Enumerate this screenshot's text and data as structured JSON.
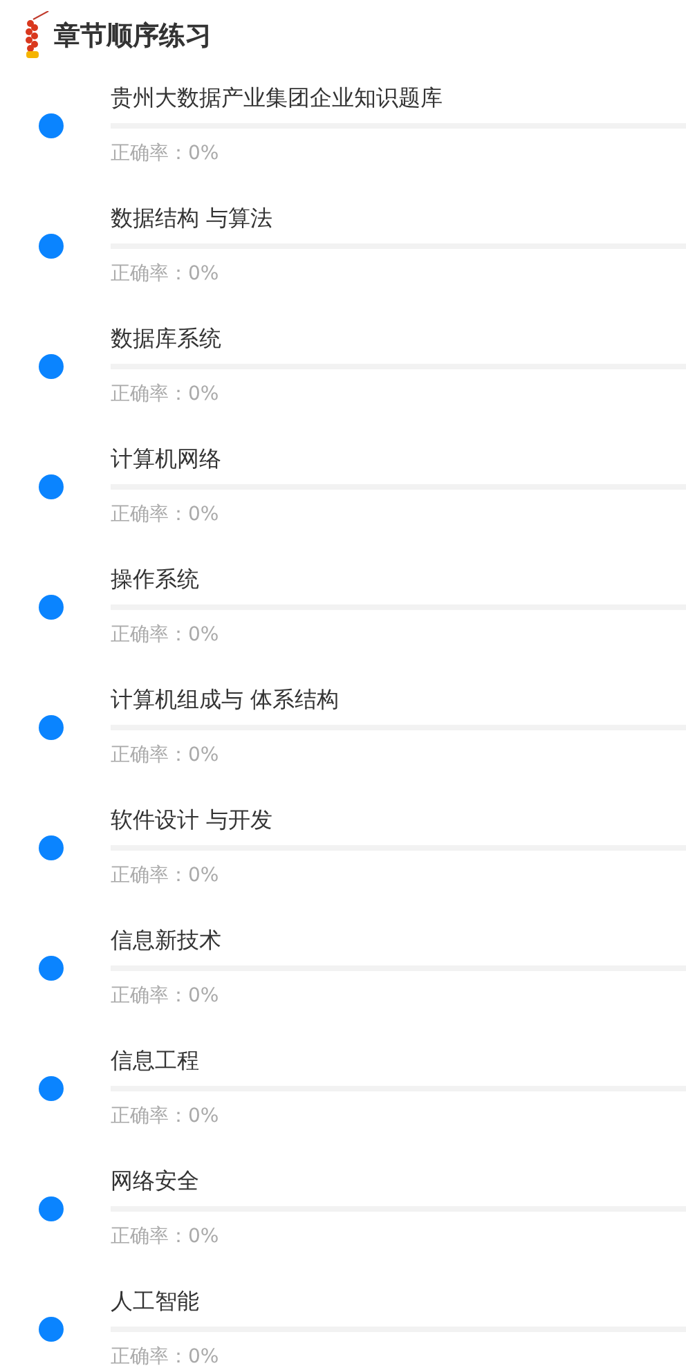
{
  "title": "章节顺序练习",
  "chapters": [
    {
      "name": "贵州大数据产业集团企业知识题库",
      "level": 0,
      "accuracy": "正确率：0%"
    },
    {
      "name": "数据结构 与算法",
      "level": 0,
      "accuracy": "正确率：0%"
    },
    {
      "name": "数据库系统",
      "level": 0,
      "accuracy": "正确率：0%"
    },
    {
      "name": "计算机网络",
      "level": 0,
      "accuracy": "正确率：0%"
    },
    {
      "name": "操作系统",
      "level": 0,
      "accuracy": "正确率：0%"
    },
    {
      "name": "计算机组成与 体系结构",
      "level": 0,
      "accuracy": "正确率：0%"
    },
    {
      "name": "软件设计 与开发",
      "level": 0,
      "accuracy": "正确率：0%"
    },
    {
      "name": "信息新技术",
      "level": 0,
      "accuracy": "正确率：0%"
    },
    {
      "name": "信息工程",
      "level": 0,
      "accuracy": "正确率：0%"
    },
    {
      "name": "网络安全",
      "level": 0,
      "accuracy": "正确率：0%"
    },
    {
      "name": "人工智能",
      "level": 0,
      "accuracy": "正确率：0%"
    }
  ]
}
